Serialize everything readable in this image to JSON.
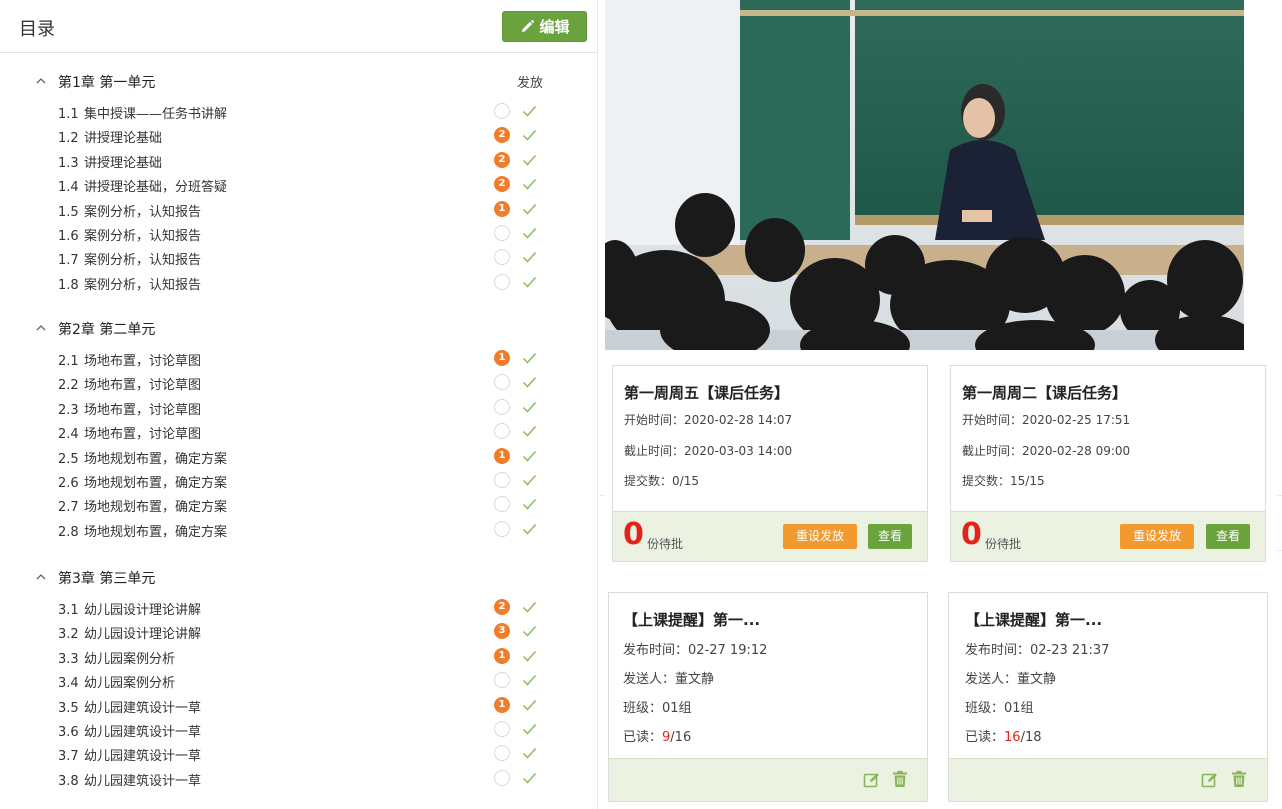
{
  "toc": {
    "title": "目录",
    "edit_label": "编辑",
    "column_header": "发放",
    "chapters": [
      {
        "title": "第1章 第一单元",
        "lessons": [
          {
            "num": "1.1",
            "title": "集中授课——任务书讲解",
            "badge": ""
          },
          {
            "num": "1.2",
            "title": "讲授理论基础",
            "badge": "2"
          },
          {
            "num": "1.3",
            "title": "讲授理论基础",
            "badge": "2"
          },
          {
            "num": "1.4",
            "title": "讲授理论基础，分班答疑",
            "badge": "2"
          },
          {
            "num": "1.5",
            "title": "案例分析，认知报告",
            "badge": "1"
          },
          {
            "num": "1.6",
            "title": "案例分析，认知报告",
            "badge": ""
          },
          {
            "num": "1.7",
            "title": "案例分析，认知报告",
            "badge": ""
          },
          {
            "num": "1.8",
            "title": "案例分析，认知报告",
            "badge": ""
          }
        ]
      },
      {
        "title": "第2章 第二单元",
        "lessons": [
          {
            "num": "2.1",
            "title": "场地布置，讨论草图",
            "badge": "1"
          },
          {
            "num": "2.2",
            "title": "场地布置，讨论草图",
            "badge": ""
          },
          {
            "num": "2.3",
            "title": "场地布置，讨论草图",
            "badge": ""
          },
          {
            "num": "2.4",
            "title": "场地布置，讨论草图",
            "badge": ""
          },
          {
            "num": "2.5",
            "title": "场地规划布置，确定方案",
            "badge": "1"
          },
          {
            "num": "2.6",
            "title": "场地规划布置，确定方案",
            "badge": ""
          },
          {
            "num": "2.7",
            "title": "场地规划布置，确定方案",
            "badge": ""
          },
          {
            "num": "2.8",
            "title": "场地规划布置，确定方案",
            "badge": ""
          }
        ]
      },
      {
        "title": "第3章 第三单元",
        "lessons": [
          {
            "num": "3.1",
            "title": "幼儿园设计理论讲解",
            "badge": "2"
          },
          {
            "num": "3.2",
            "title": "幼儿园设计理论讲解",
            "badge": "3"
          },
          {
            "num": "3.3",
            "title": "幼儿园案例分析",
            "badge": "1"
          },
          {
            "num": "3.4",
            "title": "幼儿园案例分析",
            "badge": ""
          },
          {
            "num": "3.5",
            "title": "幼儿园建筑设计一草",
            "badge": "1"
          },
          {
            "num": "3.6",
            "title": "幼儿园建筑设计一草",
            "badge": ""
          },
          {
            "num": "3.7",
            "title": "幼儿园建筑设计一草",
            "badge": ""
          },
          {
            "num": "3.8",
            "title": "幼儿园建筑设计一草",
            "badge": ""
          }
        ]
      }
    ]
  },
  "task_cards": [
    {
      "title": "第一周周五【课后任务】",
      "start_label": "开始时间：",
      "start": "2020-02-28 14:07",
      "end_label": "截止时间：",
      "end": "2020-03-03 14:00",
      "submit_label": "提交数：",
      "submit": "0/15",
      "pending": "0",
      "pending_text": "份待批",
      "reset_label": "重设发放",
      "view_label": "查看"
    },
    {
      "title": "第一周周二【课后任务】",
      "start_label": "开始时间：",
      "start": "2020-02-25 17:51",
      "end_label": "截止时间：",
      "end": "2020-02-28 09:00",
      "submit_label": "提交数：",
      "submit": "15/15",
      "pending": "0",
      "pending_text": "份待批",
      "reset_label": "重设发放",
      "view_label": "查看"
    }
  ],
  "notice_cards": [
    {
      "title": "【上课提醒】第一...",
      "time_label": "发布时间：",
      "time": "02-27 19:12",
      "sender_label": "发送人：",
      "sender": "董文静",
      "class_label": "班级：",
      "class": "01组",
      "read_label": "已读：",
      "read": "9",
      "total": "/16"
    },
    {
      "title": "【上课提醒】第一...",
      "time_label": "发布时间：",
      "time": "02-23 21:37",
      "sender_label": "发送人：",
      "sender": "董文静",
      "class_label": "班级：",
      "class": "01组",
      "read_label": "已读：",
      "read": "16",
      "total": "/18"
    }
  ],
  "colors": {
    "accent_green": "#6aa33d",
    "badge_orange": "#f07d2a",
    "reset_orange": "#f39a2f",
    "alert_red": "#e52218",
    "footer_bg": "#ecf2e2"
  }
}
